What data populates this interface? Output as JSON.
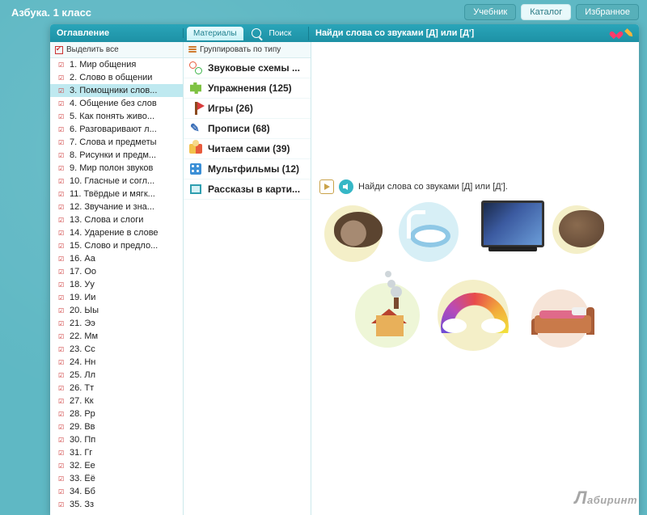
{
  "app_title": "Азбука. 1 класс",
  "top_buttons": {
    "textbook": "Учебник",
    "catalog": "Каталог",
    "favorites": "Избранное"
  },
  "headers": {
    "toc": "Оглавление",
    "materials_tab": "Материалы",
    "search_tab": "Поиск",
    "content_title": "Найди слова со звуками [Д] или [Д']"
  },
  "subheaders": {
    "select_all": "Выделить все",
    "group_by_type": "Группировать по типу"
  },
  "task_text": "Найди слова со звуками [Д] или [Д'].",
  "toc": [
    "1. Мир общения",
    "2. Слово в общении",
    "3. Помощники слов...",
    "4. Общение без слов",
    "5. Как понять живо...",
    "6. Разговаривают л...",
    "7. Слова и предметы",
    "8. Рисунки и предм...",
    "9. Мир полон звуков",
    "10. Гласные и согл...",
    "11. Твёрдые и мягк...",
    "12. Звучание и зна...",
    "13. Слова и слоги",
    "14. Ударение в слове",
    "15. Слово и предло...",
    "16. Аа",
    "17. Оо",
    "18. Уу",
    "19. Ии",
    "20. Ыы",
    "21. Ээ",
    "22. Мм",
    "23. Сс",
    "24. Нн",
    "25. Лл",
    "26. Тт",
    "27. Кк",
    "28. Рр",
    "29. Вв",
    "30. Пп",
    "31. Гг",
    "32. Ее",
    "33. Ёё",
    "34. Бб",
    "35. Зз"
  ],
  "toc_selected_index": 2,
  "materials": [
    {
      "icon": "scheme",
      "label": "Звуковые схемы ..."
    },
    {
      "icon": "puzzle",
      "label": "Упражнения (125)"
    },
    {
      "icon": "flag",
      "label": "Игры (26)"
    },
    {
      "icon": "pen",
      "label": "Прописи (68)"
    },
    {
      "icon": "read",
      "label": "Читаем сами (39)"
    },
    {
      "icon": "film",
      "label": "Мультфильмы (12)"
    },
    {
      "icon": "frame",
      "label": "Рассказы в карти..."
    }
  ],
  "watermark": "абиринт"
}
